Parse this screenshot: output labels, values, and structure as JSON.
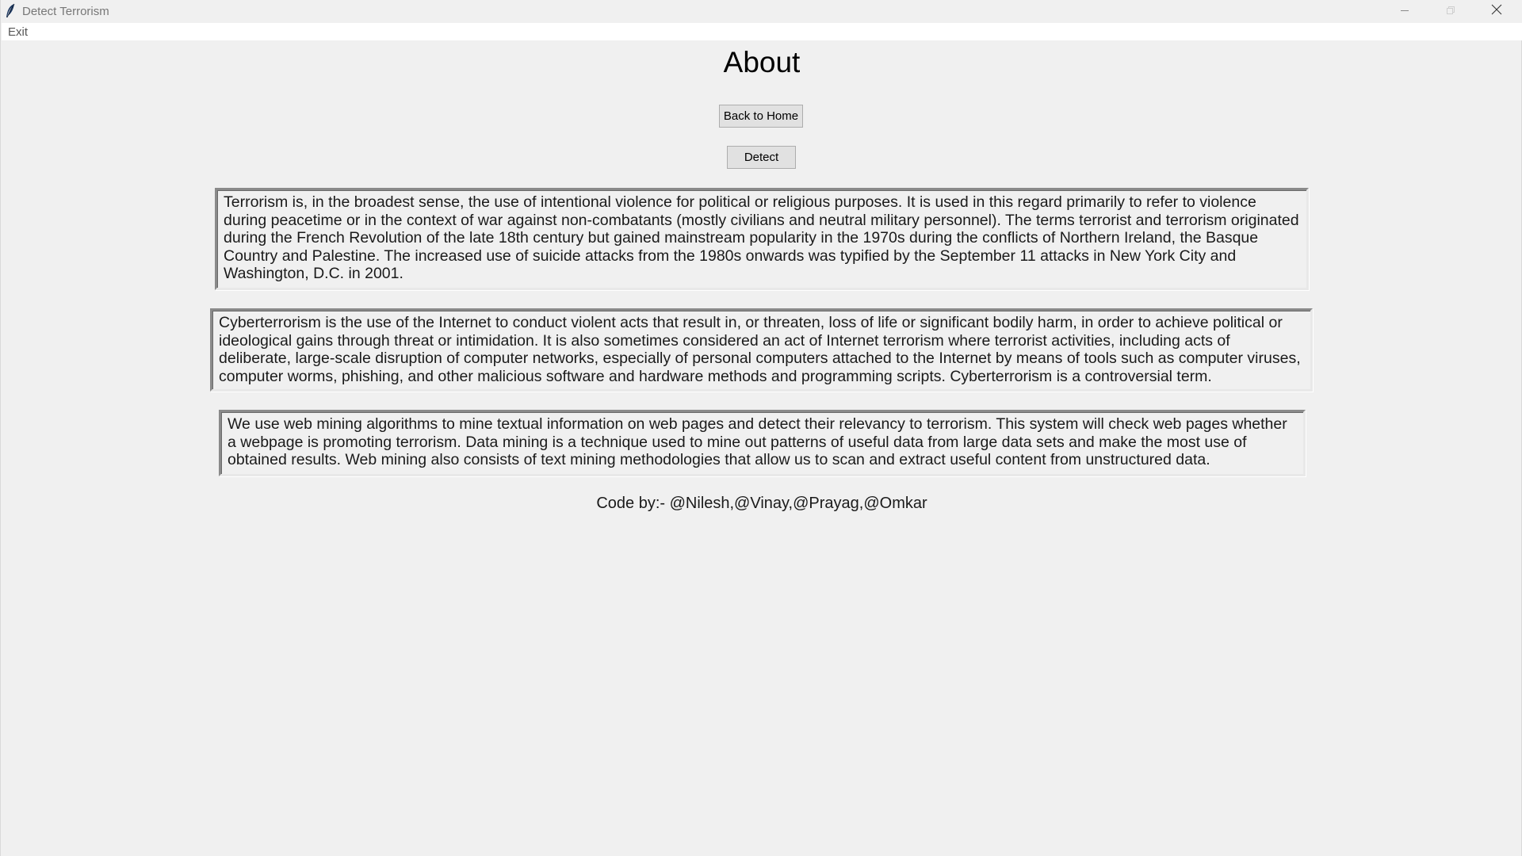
{
  "window": {
    "title": "Detect Terrorism",
    "icons": {
      "app": "feather-icon",
      "minimize": "minimize-icon",
      "maximize": "maximize-icon",
      "close": "close-icon"
    }
  },
  "menubar": {
    "items": [
      {
        "label": "Exit"
      }
    ]
  },
  "content": {
    "heading": "About",
    "back_button_label": "Back to Home",
    "detect_button_label": "Detect",
    "paragraphs": [
      {
        "text": "Terrorism is, in the broadest sense, the use of intentional violence for political or religious purposes. It is used in this regard primarily to refer to violence during peacetime or in the context of war against non-combatants (mostly civilians and neutral military personnel). The terms terrorist and terrorism originated during the French Revolution of the late 18th century but gained mainstream popularity in the 1970s during the conflicts of Northern Ireland, the Basque Country and Palestine. The increased use of suicide attacks from the 1980s onwards was typified by the September 11 attacks in New York City and Washington, D.C. in 2001."
      },
      {
        "text": "Cyberterrorism is the use of the Internet to conduct violent acts that result in, or threaten, loss of life or significant bodily harm, in order to achieve political or ideological gains through threat or intimidation. It is also sometimes considered an act of Internet terrorism where terrorist activities, including acts of deliberate, large-scale disruption of computer networks, especially of personal computers attached to the Internet by means of tools such as computer viruses, computer worms, phishing, and other malicious software and hardware methods and programming scripts. Cyberterrorism is a controversial term."
      },
      {
        "text": "We use web mining algorithms to mine textual information on web pages and detect their relevancy to terrorism. This system will check web pages whether a webpage is promoting terrorism. Data mining is a technique used to mine out patterns of useful data from large data sets and make the most use of obtained results. Web mining also consists of text mining methodologies that allow us to scan and extract useful content from unstructured data."
      }
    ],
    "credit": "Code by:- @Nilesh,@Vinay,@Prayag,@Omkar"
  },
  "colors": {
    "background": "#f0f0f0",
    "menubar": "#ffffff",
    "button_face": "#e1e1e1",
    "title_text": "#777777"
  }
}
